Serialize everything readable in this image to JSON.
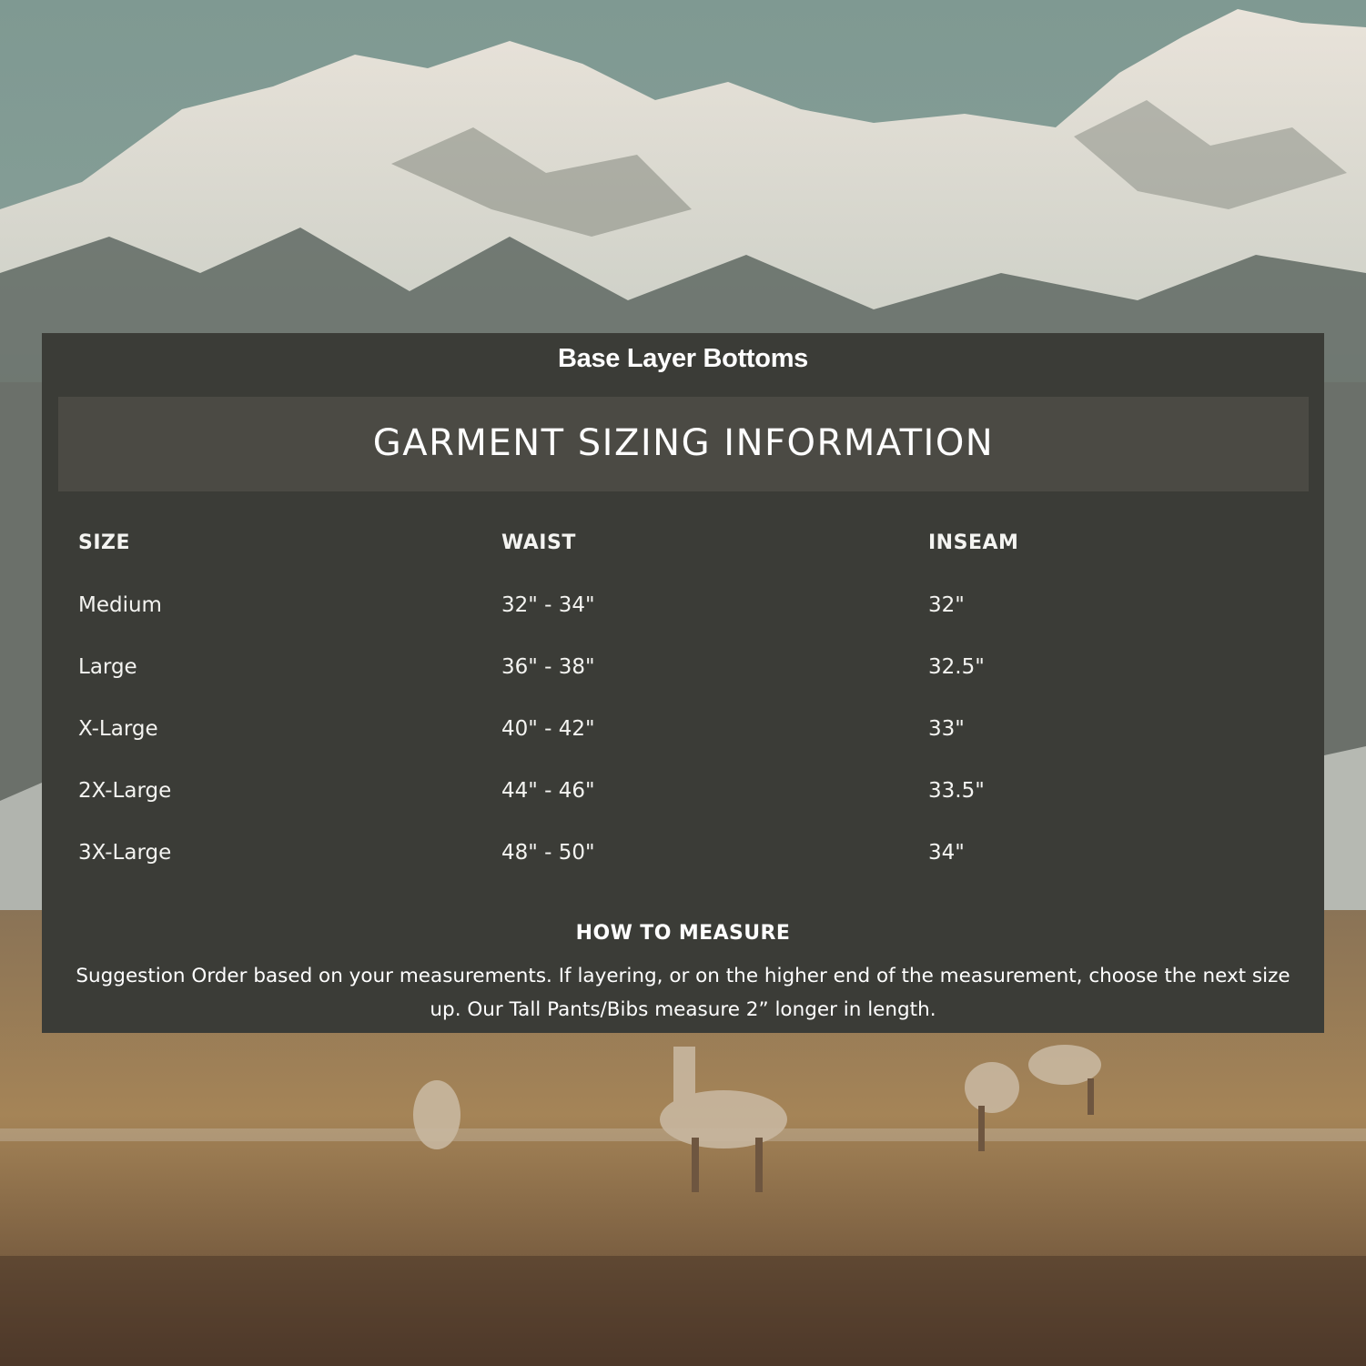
{
  "product": {
    "title": "Base Layer Bottoms"
  },
  "banner": {
    "title": "GARMENT SIZING INFORMATION"
  },
  "table": {
    "headers": [
      "SIZE",
      "WAIST",
      "INSEAM"
    ],
    "rows": [
      [
        "Medium",
        "32\" - 34\"",
        "32\""
      ],
      [
        "Large",
        "36\" - 38\"",
        "32.5\""
      ],
      [
        "X-Large",
        "40\" - 42\"",
        "33\""
      ],
      [
        "2X-Large",
        "44\" - 46\"",
        "33.5\""
      ],
      [
        "3X-Large",
        "48\" - 50\"",
        "34\""
      ]
    ]
  },
  "measure": {
    "title": "HOW TO MEASURE",
    "text": "Suggestion Order based on your measurements. If layering, or on the higher end of the measurement, choose the next size up. Our Tall Pants/Bibs measure 2” longer in length."
  },
  "colors": {
    "panel": "#3b3c37",
    "banner": "#4b4a44",
    "text": "#ffffff"
  }
}
